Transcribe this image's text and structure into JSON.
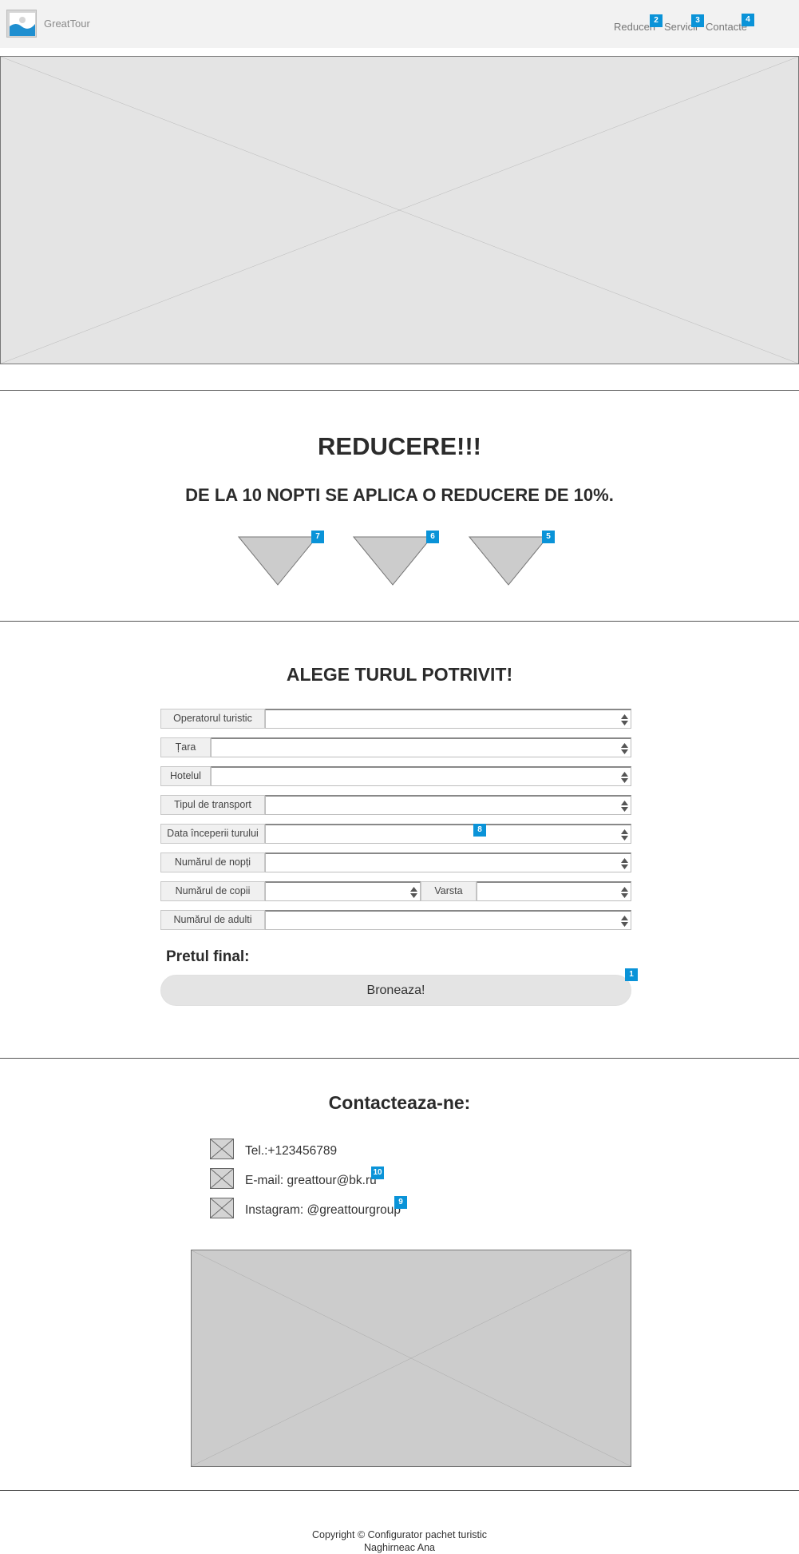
{
  "header": {
    "brand": "GreatTour",
    "nav": [
      "Reduceri",
      "Servicii",
      "Contacte"
    ]
  },
  "discount": {
    "title": "REDUCERE!!!",
    "subtitle": "DE LA 10 NOPTI SE APLICA O REDUCERE DE 10%."
  },
  "form": {
    "title": "ALEGE TURUL POTRIVIT!",
    "fields": {
      "operator": "Operatorul turistic",
      "country": "Țara",
      "hotel": "Hotelul",
      "transport": "Tipul de transport",
      "start_date": "Data începerii turului",
      "nights": "Numărul de nopți",
      "children": "Numărul de copii",
      "age": "Varsta",
      "adults": "Numărul de adulti"
    },
    "price_label": "Pretul final:",
    "book_button": "Broneaza!"
  },
  "contacts": {
    "title": "Contacteaza-ne:",
    "phone": "Tel.:+123456789",
    "email": "E-mail: greattour@bk.ru",
    "instagram": "Instagram: @greattourgroup"
  },
  "footer": {
    "copyright": "Copyright © Configurator pachet turistic",
    "author": "Naghirneac Ana"
  },
  "badges": {
    "book": "1",
    "nav_reduceri": "2",
    "nav_servicii": "3",
    "nav_contacte": "4",
    "tri_right": "5",
    "tri_middle": "6",
    "tri_left": "7",
    "start_date": "8",
    "instagram": "9",
    "email": "10"
  },
  "colors": {
    "badge": "#0a93d8",
    "header_bg": "#f2f2f2",
    "placeholder_bg": "#e4e4e4",
    "map_bg": "#cccccc"
  }
}
